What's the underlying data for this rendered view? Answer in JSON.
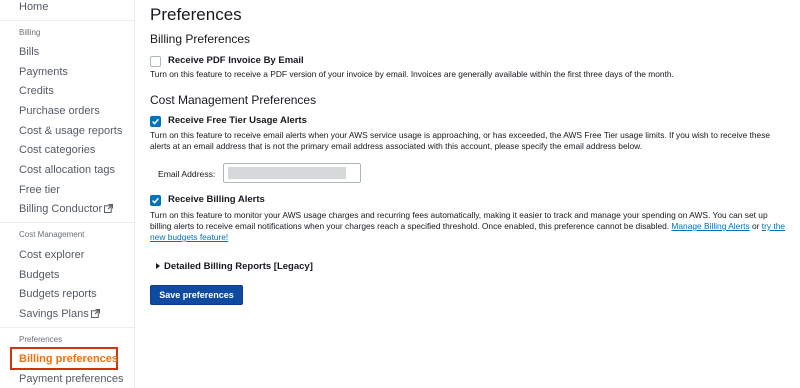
{
  "sidebar": {
    "home": "Home",
    "billing_section": "Billing",
    "billing_items": [
      "Bills",
      "Payments",
      "Credits",
      "Purchase orders",
      "Cost & usage reports",
      "Cost categories",
      "Cost allocation tags",
      "Free tier",
      "Billing Conductor"
    ],
    "cost_section": "Cost Management",
    "cost_items": [
      "Cost explorer",
      "Budgets",
      "Budgets reports",
      "Savings Plans"
    ],
    "pref_section": "Preferences",
    "pref_items": [
      "Billing preferences",
      "Payment preferences"
    ],
    "active_item": "Billing preferences"
  },
  "page": {
    "title": "Preferences",
    "billing_heading": "Billing Preferences",
    "cost_heading": "Cost Management Preferences"
  },
  "options": {
    "pdf": {
      "label": "Receive PDF Invoice By Email",
      "checked": false,
      "desc": "Turn on this feature to receive a PDF version of your invoice by email. Invoices are generally available within the first three days of the month."
    },
    "free_tier": {
      "label": "Receive Free Tier Usage Alerts",
      "checked": true,
      "desc": "Turn on this feature to receive email alerts when your AWS service usage is approaching, or has exceeded, the AWS Free Tier usage limits. If you wish to receive these alerts at an email address that is not the primary email address associated with this account, please specify the email address below.",
      "email_label": "Email Address:"
    },
    "billing_alerts": {
      "label": "Receive Billing Alerts",
      "checked": true,
      "desc": "Turn on this feature to monitor your AWS usage charges and recurring fees automatically, making it easier to track and manage your spending on AWS. You can set up billing alerts to receive email notifications when your charges reach a specified threshold. Once enabled, this preference cannot be disabled.",
      "link1": "Manage Billing Alerts",
      "or": "or",
      "link2": "try the new budgets feature!"
    }
  },
  "detailed_reports": "Detailed Billing Reports [Legacy]",
  "save_button": "Save preferences",
  "colors": {
    "accent": "#0073bb",
    "button": "#0e4ba0",
    "active": "#ec7211",
    "highlight_box": "#d13212"
  }
}
